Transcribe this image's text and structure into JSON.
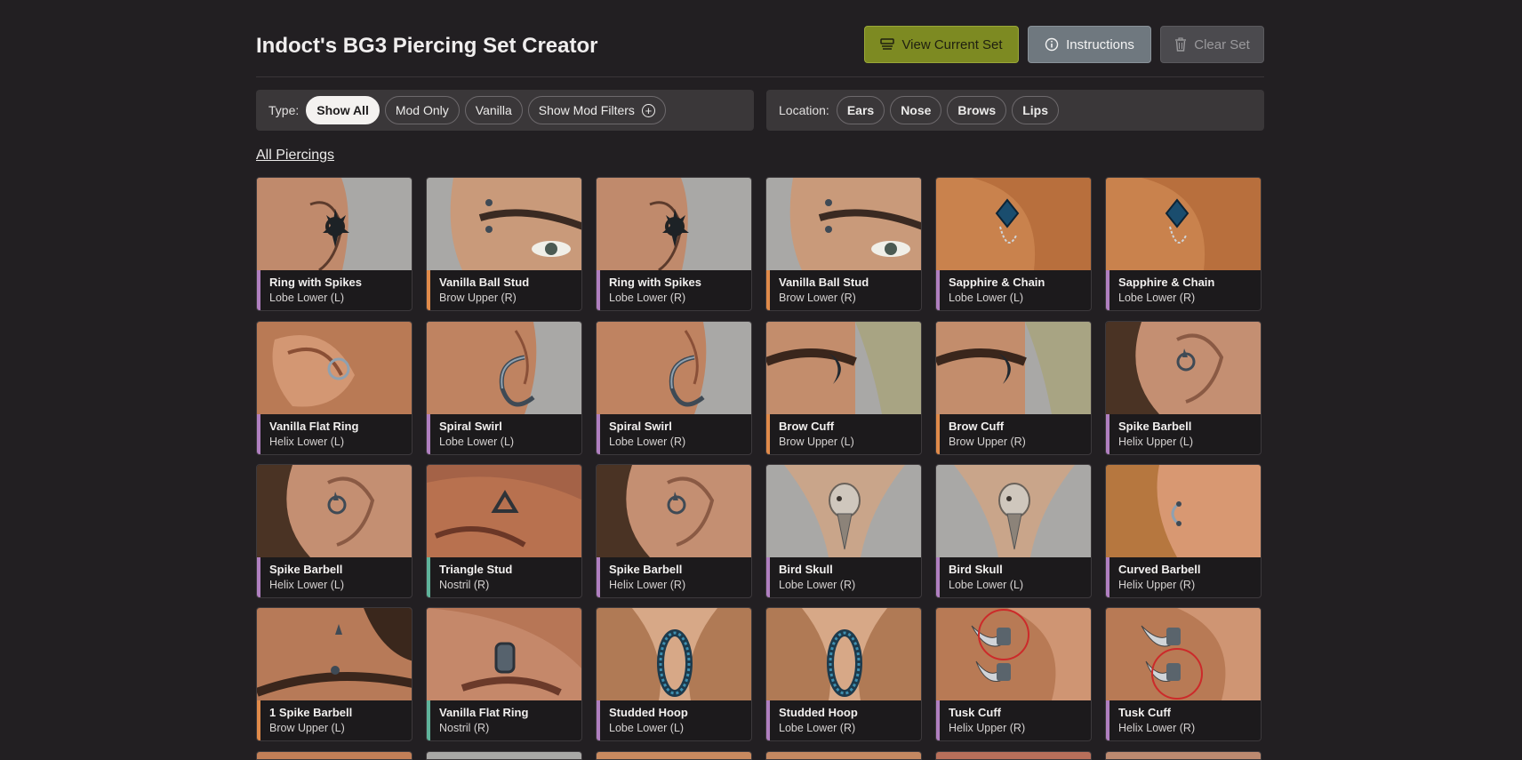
{
  "header": {
    "title": "Indoct's BG3 Piercing Set Creator",
    "view_label": "View Current Set",
    "instructions_label": "Instructions",
    "clear_label": "Clear Set"
  },
  "filters": {
    "type_label": "Type:",
    "type_options": [
      "Show All",
      "Mod Only",
      "Vanilla",
      "Show Mod Filters"
    ],
    "type_selected": "Show All",
    "location_label": "Location:",
    "location_options": [
      "Ears",
      "Nose",
      "Brows",
      "Lips"
    ]
  },
  "section_title": "All Piercings",
  "colors": {
    "background": "#221f22",
    "ear_stripe": "#b07fc0",
    "brow_stripe": "#e08a4a",
    "nose_stripe": "#5fb39a",
    "view_button": "#7d8a22",
    "instructions_button": "#6f787f",
    "clear_button": "#4b4a4e"
  },
  "cards": [
    {
      "name": "Ring with Spikes",
      "location": "Lobe Lower (L)",
      "category": "ear",
      "icon": "spike-ring-icon"
    },
    {
      "name": "Vanilla Ball Stud",
      "location": "Brow Upper (R)",
      "category": "brow",
      "icon": "brow-stud-icon"
    },
    {
      "name": "Ring with Spikes",
      "location": "Lobe Lower (R)",
      "category": "ear",
      "icon": "spike-ring-icon"
    },
    {
      "name": "Vanilla Ball Stud",
      "location": "Brow Lower (R)",
      "category": "brow",
      "icon": "brow-stud-icon"
    },
    {
      "name": "Sapphire & Chain",
      "location": "Lobe Lower (L)",
      "category": "ear",
      "icon": "sapphire-chain-icon"
    },
    {
      "name": "Sapphire & Chain",
      "location": "Lobe Lower (R)",
      "category": "ear",
      "icon": "sapphire-chain-icon"
    },
    {
      "name": "Vanilla Flat Ring",
      "location": "Helix Lower (L)",
      "category": "ear",
      "icon": "flat-ring-icon"
    },
    {
      "name": "Spiral Swirl",
      "location": "Lobe Lower (L)",
      "category": "ear",
      "icon": "spiral-icon"
    },
    {
      "name": "Spiral Swirl",
      "location": "Lobe Lower (R)",
      "category": "ear",
      "icon": "spiral-icon"
    },
    {
      "name": "Brow Cuff",
      "location": "Brow Upper (L)",
      "category": "brow",
      "icon": "brow-cuff-icon"
    },
    {
      "name": "Brow Cuff",
      "location": "Brow Upper (R)",
      "category": "brow",
      "icon": "brow-cuff-icon"
    },
    {
      "name": "Spike Barbell",
      "location": "Helix Upper (L)",
      "category": "ear",
      "icon": "spike-barbell-icon"
    },
    {
      "name": "Spike Barbell",
      "location": "Helix Lower (L)",
      "category": "ear",
      "icon": "spike-barbell-icon"
    },
    {
      "name": "Triangle Stud",
      "location": "Nostril (R)",
      "category": "nose",
      "icon": "triangle-stud-icon"
    },
    {
      "name": "Spike Barbell",
      "location": "Helix Lower (R)",
      "category": "ear",
      "icon": "spike-barbell-icon"
    },
    {
      "name": "Bird Skull",
      "location": "Lobe Lower (R)",
      "category": "ear",
      "icon": "bird-skull-icon"
    },
    {
      "name": "Bird Skull",
      "location": "Lobe Lower (L)",
      "category": "ear",
      "icon": "bird-skull-icon"
    },
    {
      "name": "Curved Barbell",
      "location": "Helix Upper (R)",
      "category": "ear",
      "icon": "curved-barbell-icon"
    },
    {
      "name": "1 Spike Barbell",
      "location": "Brow Upper (L)",
      "category": "brow",
      "icon": "brow-spike-icon"
    },
    {
      "name": "Vanilla Flat Ring",
      "location": "Nostril (R)",
      "category": "nose",
      "icon": "nose-ring-icon"
    },
    {
      "name": "Studded Hoop",
      "location": "Lobe Lower (L)",
      "category": "ear",
      "icon": "studded-hoop-icon"
    },
    {
      "name": "Studded Hoop",
      "location": "Lobe Lower (R)",
      "category": "ear",
      "icon": "studded-hoop-icon"
    },
    {
      "name": "Tusk Cuff",
      "location": "Helix Upper (R)",
      "category": "ear",
      "icon": "tusk-cuff-icon"
    },
    {
      "name": "Tusk Cuff",
      "location": "Helix Lower (R)",
      "category": "ear",
      "icon": "tusk-cuff-icon"
    }
  ]
}
